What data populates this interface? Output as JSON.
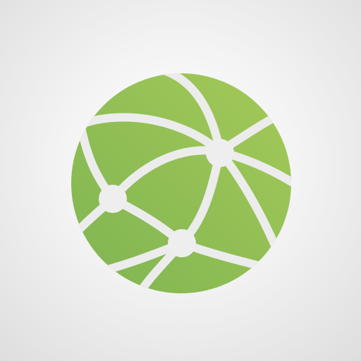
{
  "icon": {
    "name": "network-globe-icon",
    "colors": {
      "globe_light": "#a4ca58",
      "globe_dark": "#7fb452",
      "lines": "#ececec",
      "nodes": "#eeeeee",
      "background_center": "#ffffff",
      "background_edge": "#dedede"
    }
  }
}
